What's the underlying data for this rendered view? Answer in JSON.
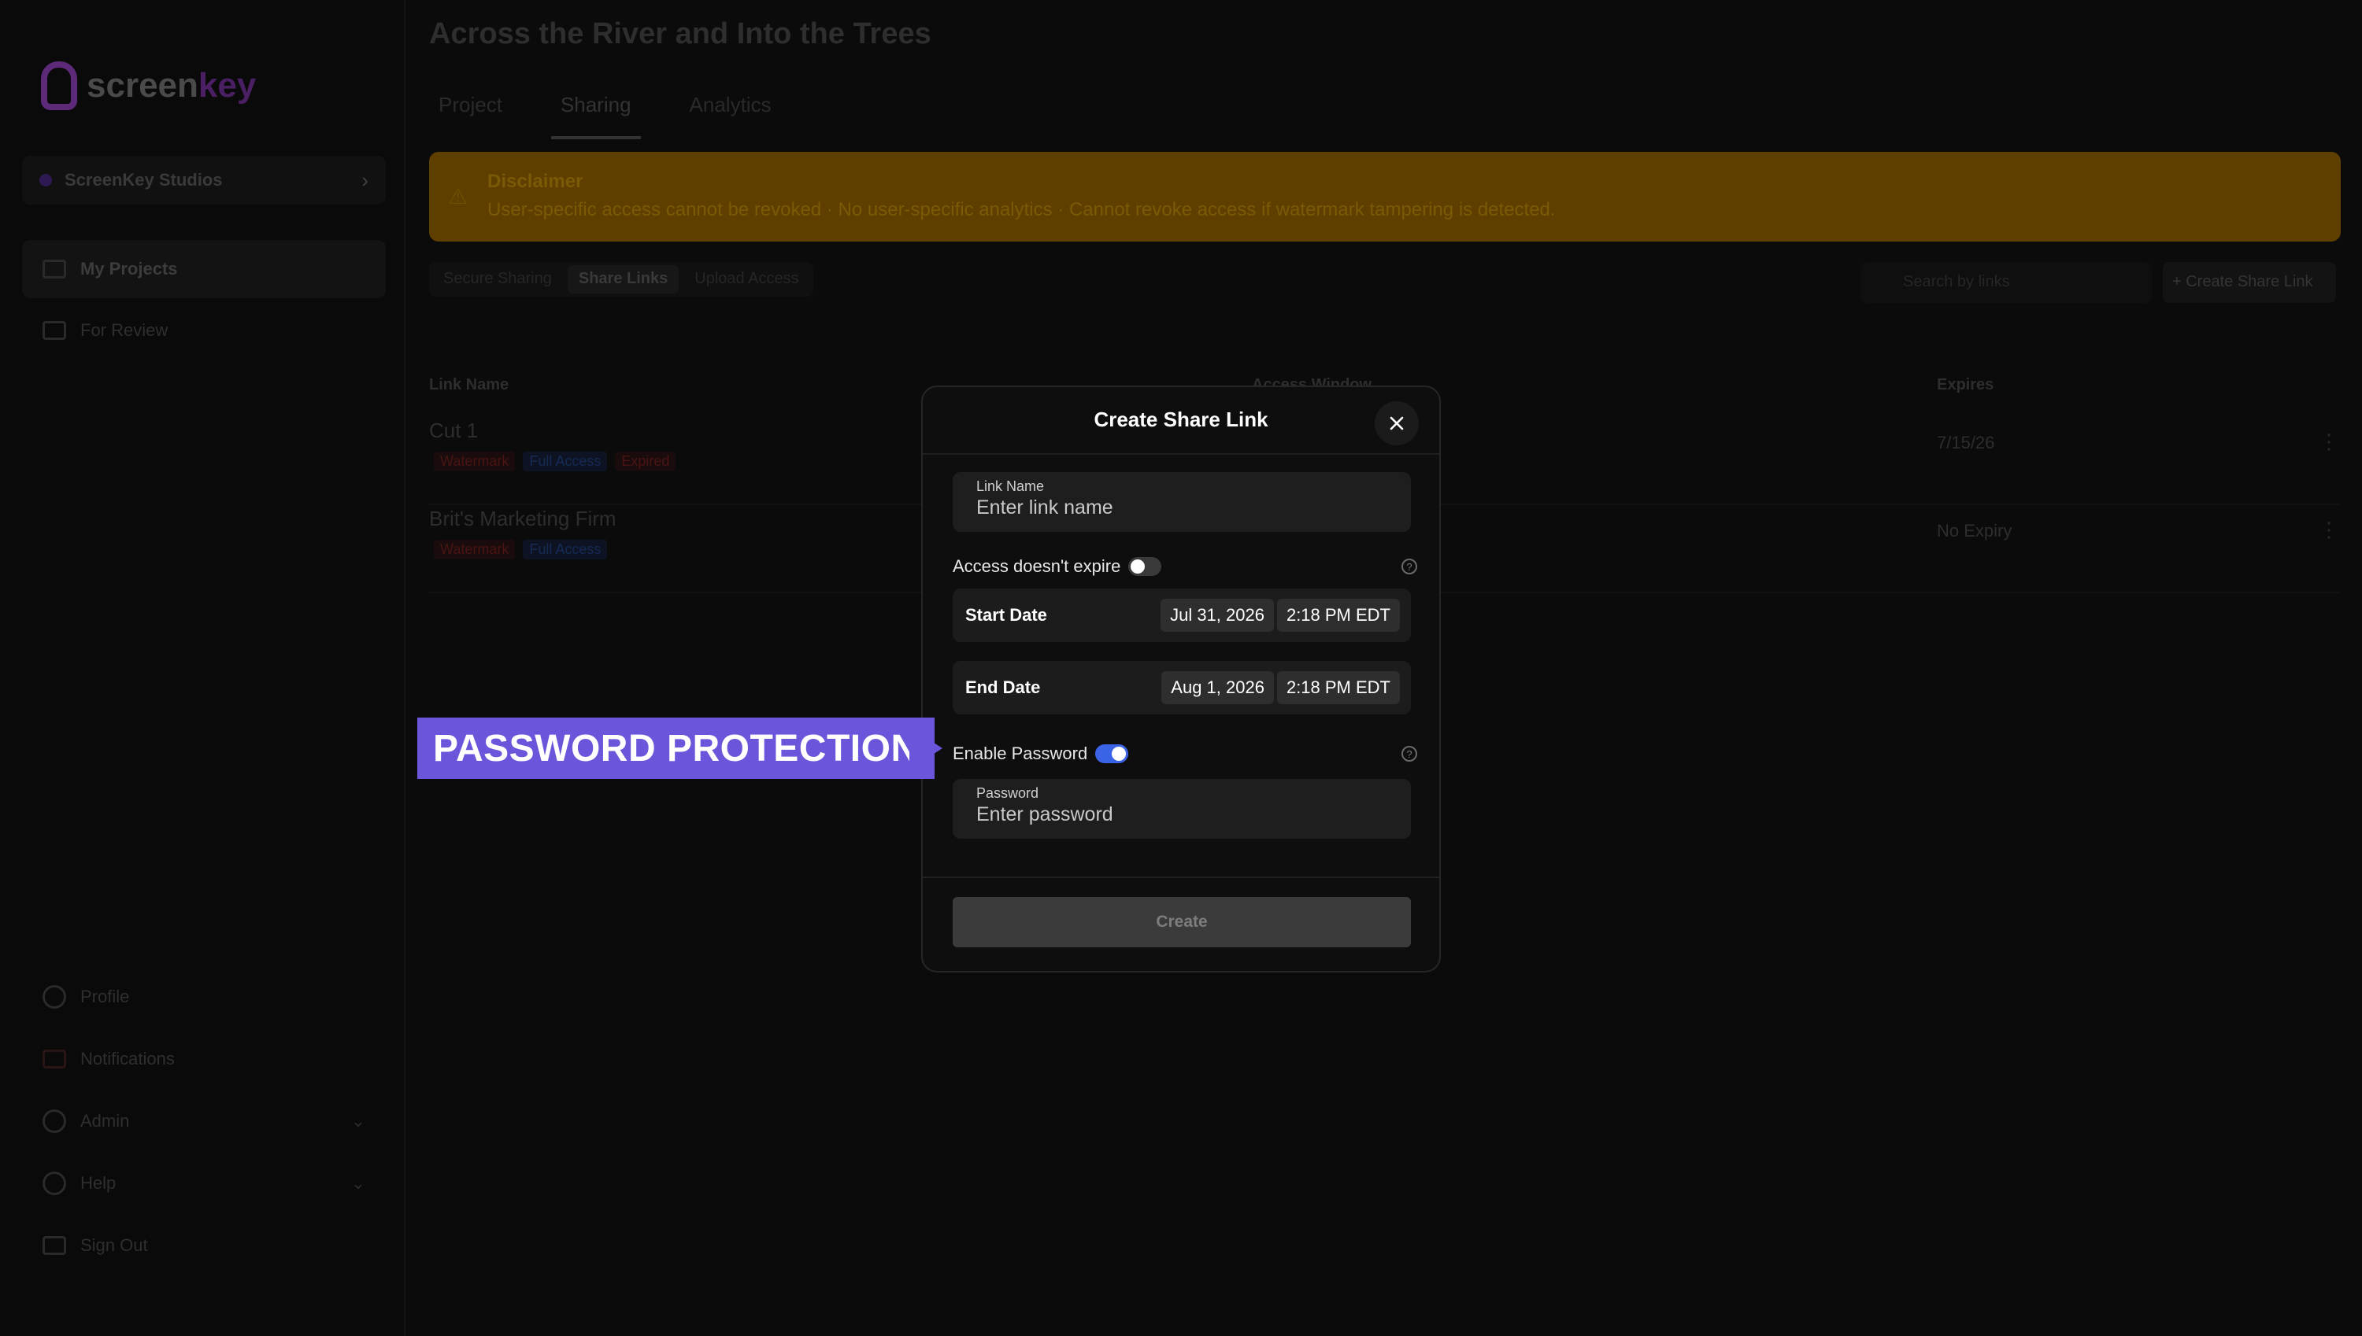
{
  "sidebar": {
    "logo_text": "screen",
    "logo_text_accent": "key",
    "org_name": "ScreenKey Studios",
    "nav_top": [
      {
        "label": "My Projects"
      },
      {
        "label": "For Review"
      }
    ],
    "nav_bottom": [
      {
        "label": "Profile"
      },
      {
        "label": "Notifications"
      },
      {
        "label": "Admin"
      },
      {
        "label": "Help"
      },
      {
        "label": "Sign Out"
      }
    ]
  },
  "main": {
    "title": "Across the River and Into the Trees",
    "tabs": [
      {
        "label": "Project"
      },
      {
        "label": "Sharing"
      },
      {
        "label": "Analytics"
      }
    ],
    "banner": {
      "title": "Disclaimer",
      "text": "User-specific access cannot be revoked · No user-specific analytics · Cannot revoke access if watermark tampering is detected."
    },
    "segments": [
      {
        "label": "Secure Sharing"
      },
      {
        "label": "Share Links"
      },
      {
        "label": "Upload Access"
      }
    ],
    "search_placeholder": "Search by links",
    "create_button": "+ Create Share Link",
    "table": {
      "headers": [
        "Link Name",
        "Access Window",
        "Expires"
      ],
      "rows": [
        {
          "name": "Cut 1",
          "chips": [
            "Watermark",
            "Full Access",
            "Expired"
          ],
          "expires": "7/15/26"
        },
        {
          "name": "Brit's Marketing Firm",
          "chips": [
            "Watermark",
            "Full Access"
          ],
          "expires": "No Expiry"
        }
      ]
    }
  },
  "modal": {
    "title": "Create Share Link",
    "link_name": {
      "label": "Link Name",
      "placeholder": "Enter link name",
      "value": ""
    },
    "no_expire": {
      "label": "Access doesn't expire",
      "enabled": false
    },
    "start": {
      "label": "Start Date",
      "date": "Jul 31, 2026",
      "time": "2:18 PM EDT"
    },
    "end": {
      "label": "End Date",
      "date": "Aug 1, 2026",
      "time": "2:18 PM EDT"
    },
    "enable_password": {
      "label": "Enable Password",
      "enabled": true
    },
    "password": {
      "label": "Password",
      "placeholder": "Enter password",
      "value": ""
    },
    "submit_label": "Create"
  },
  "callout": {
    "text": "PASSWORD PROTECTION",
    "color": "#6b55db"
  },
  "colors": {
    "toggle_on": "#3b63e6",
    "banner": "#5e3f00"
  }
}
